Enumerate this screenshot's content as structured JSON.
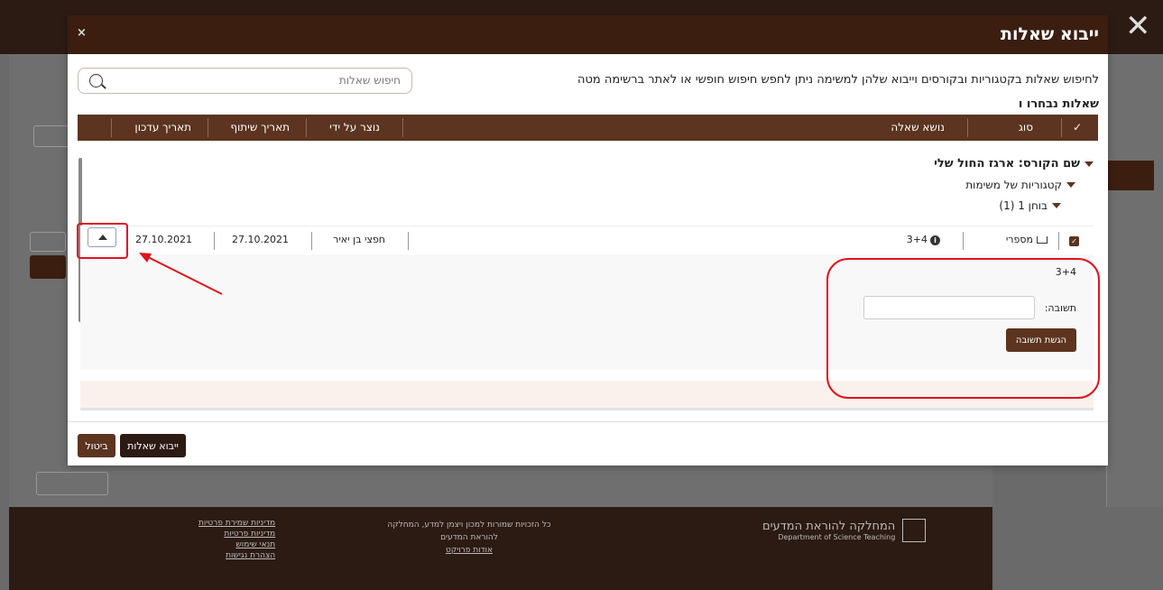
{
  "modal": {
    "title": "ייבוא שאלות",
    "close_glyph": "×",
    "intro_text": "לחיפוש שאלות בקטגוריות ובקורסים וייבוא שלהן למשימה ניתן לחפש חיפוש חופשי או לאתר ברשימה מטה",
    "search": {
      "placeholder": "חיפוש שאלות"
    },
    "selected_questions_title": "שאלות נבחרו ו",
    "table_headers": {
      "select": "✓",
      "type": "סוג",
      "topic": "נושא שאלה",
      "created_by": "נוצר על ידי",
      "shared_date": "תאריך שיתוף",
      "updated_date": "תאריך עדכון"
    },
    "tree": {
      "course": "שם הקורס: ארגז החול שלי",
      "category": "קטגוריות של משימות",
      "quiz": "בוחן 1 (1)"
    },
    "row": {
      "type": "מספרי",
      "topic": "3+4",
      "created_by": "חפצי בן יאיר",
      "shared_date": "27.10.2021",
      "updated_date": "27.10.2021"
    },
    "detail": {
      "question": "3+4",
      "answer_label": "תשובה:",
      "submit_label": "הגשת תשובה"
    },
    "footer": {
      "import_label": "ייבוא שאלות",
      "cancel_label": "ביטול"
    }
  },
  "background": {
    "footer_links": [
      "מדיניות שמירת פרטיות",
      "מדיניות פרטיות",
      "תנאי שימוש",
      "הצהרת נגישות"
    ],
    "footer_mid": "כל הזכויות שמורות למכון ויצמן למדע, המחלקה להוראת המדעים",
    "footer_mid_link": "אודות פרויקט",
    "footer_logo_he": "המחלקה להוראת המדעים",
    "footer_logo_en": "Department of Science Teaching",
    "close_glyph": "✕"
  },
  "colors": {
    "accent": "#5c3420",
    "header": "#3b1e10",
    "annotation": "#e0141c"
  }
}
